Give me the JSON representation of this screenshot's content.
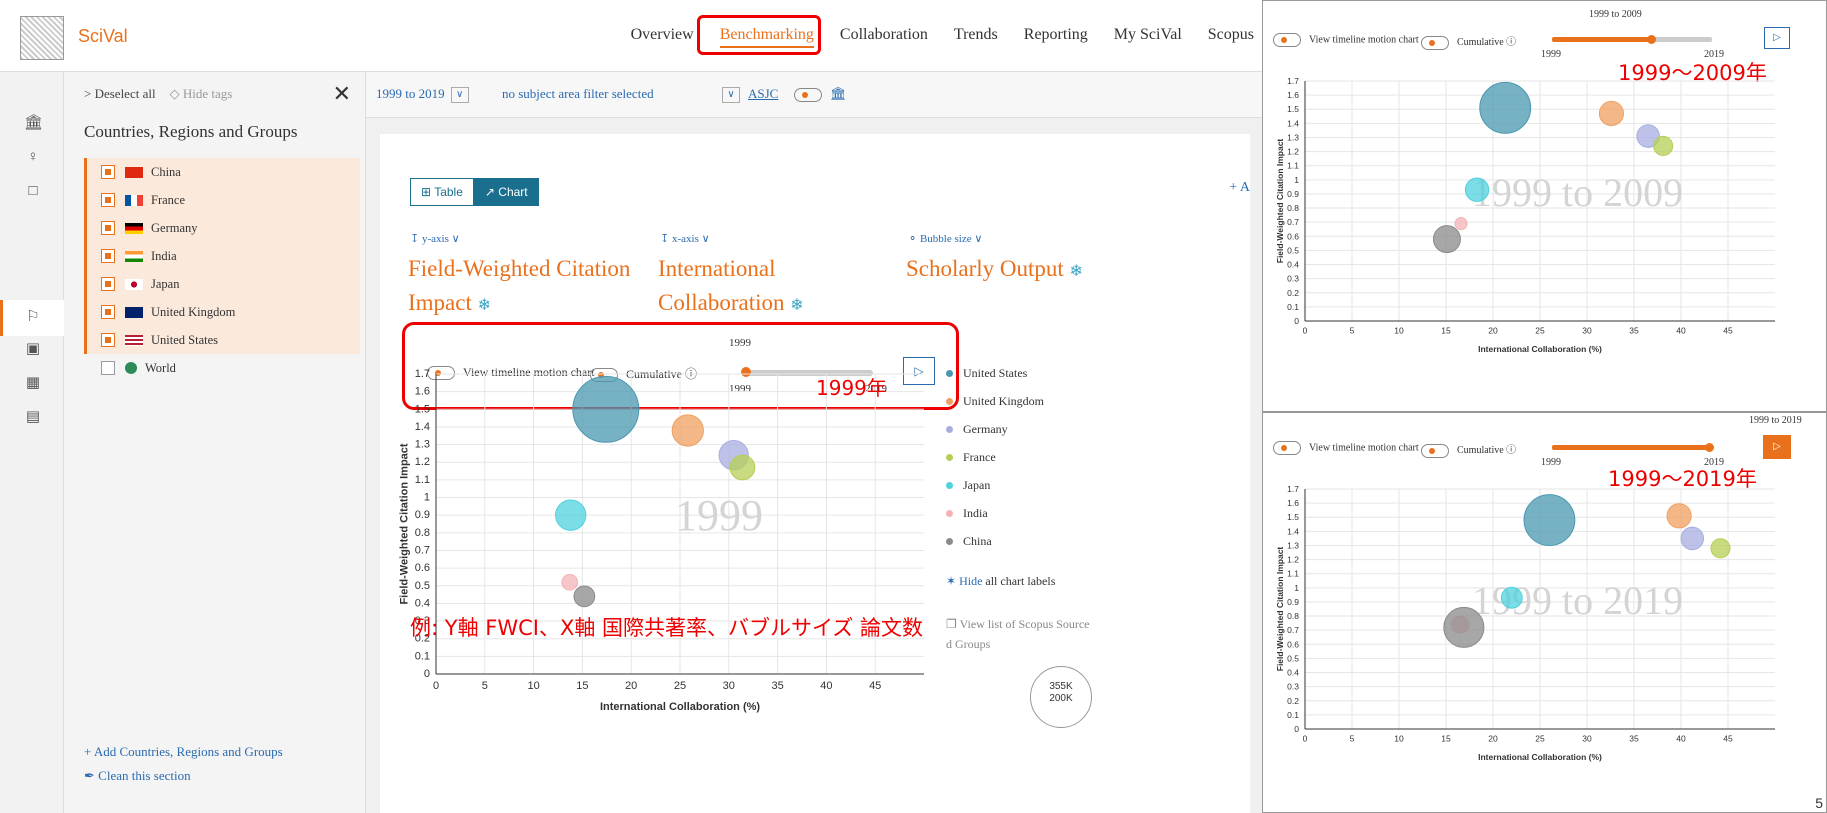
{
  "app": {
    "brand": "SciVal"
  },
  "nav": {
    "items": [
      "Overview",
      "Benchmarking",
      "Collaboration",
      "Trends",
      "Reporting",
      "My SciVal",
      "Scopus"
    ],
    "active": "Benchmarking"
  },
  "panel": {
    "deselect_all": "> Deselect all",
    "hide_tags": "Hide tags",
    "title": "Countries, Regions and Groups",
    "countries": [
      {
        "name": "China",
        "selected": true
      },
      {
        "name": "France",
        "selected": true
      },
      {
        "name": "Germany",
        "selected": true
      },
      {
        "name": "India",
        "selected": true
      },
      {
        "name": "Japan",
        "selected": true
      },
      {
        "name": "United Kingdom",
        "selected": true
      },
      {
        "name": "United States",
        "selected": true
      },
      {
        "name": "World",
        "selected": false
      }
    ],
    "add_link": "+ Add Countries, Regions and Groups",
    "clean_link": "Clean this section"
  },
  "filterbar": {
    "year_range": "1999 to 2019",
    "subject_filter": "no subject area filter selected",
    "asjc": "ASJC"
  },
  "view": {
    "table_label": "Table",
    "chart_label": "Chart",
    "add_label": "+ A"
  },
  "axes": {
    "y_selector": "y-axis",
    "x_selector": "x-axis",
    "size_selector": "Bubble size",
    "y_metric_line1": "Field-Weighted Citation",
    "y_metric_line2": "Impact",
    "x_metric_line1": "International",
    "x_metric_line2": "Collaboration",
    "size_metric": "Scholarly Output"
  },
  "timeline": {
    "view_motion": "View timeline motion chart",
    "cumulative": "Cumulative",
    "current_year": "1999",
    "start_year": "1999",
    "end_year": "2019",
    "position_fraction": 0
  },
  "legend": [
    {
      "name": "United States",
      "color": "#4a98b0"
    },
    {
      "name": "United Kingdom",
      "color": "#f0a060"
    },
    {
      "name": "Germany",
      "color": "#a8aee0"
    },
    {
      "name": "France",
      "color": "#b5cf55"
    },
    {
      "name": "Japan",
      "color": "#4fd2dc"
    },
    {
      "name": "India",
      "color": "#f3b3b6"
    },
    {
      "name": "China",
      "color": "#8a8a8a"
    }
  ],
  "hide_labels": {
    "link": "Hide",
    "text": "all chart labels"
  },
  "scopus_list": {
    "line1": "View list of Scopus Source",
    "line2": "d Groups"
  },
  "size_legend": {
    "large": "355K",
    "small": "200K"
  },
  "annotations": {
    "main_year": "1999年",
    "main_note": "例: Y軸 FWCI、X軸 国際共著率、バブルサイズ 論文数",
    "ov1_note": "1999〜2009年",
    "ov2_note": "1999〜2019年",
    "page_number": "5"
  },
  "chart_data": [
    {
      "type": "scatter",
      "title": "",
      "watermark": "1999",
      "xlabel": "International Collaboration (%)",
      "ylabel": "Field-Weighted Citation Impact",
      "xlim": [
        0,
        50
      ],
      "ylim": [
        0,
        1.7
      ],
      "xticks": [
        0,
        5,
        10,
        15,
        20,
        25,
        30,
        35,
        40,
        45
      ],
      "yticks": [
        0,
        0.1,
        0.2,
        0.3,
        0.4,
        0.5,
        0.6,
        0.7,
        0.8,
        0.9,
        1,
        1.1,
        1.2,
        1.3,
        1.4,
        1.5,
        1.6,
        1.7
      ],
      "points": [
        {
          "series": "United States",
          "x": 17.4,
          "y": 1.5,
          "size": 355
        },
        {
          "series": "United Kingdom",
          "x": 25.8,
          "y": 1.38,
          "size": 80
        },
        {
          "series": "Germany",
          "x": 30.5,
          "y": 1.24,
          "size": 70
        },
        {
          "series": "France",
          "x": 31.4,
          "y": 1.17,
          "size": 50
        },
        {
          "series": "Japan",
          "x": 13.8,
          "y": 0.9,
          "size": 75
        },
        {
          "series": "India",
          "x": 13.7,
          "y": 0.52,
          "size": 20
        },
        {
          "series": "China",
          "x": 15.2,
          "y": 0.44,
          "size": 35
        }
      ]
    },
    {
      "type": "scatter",
      "title": "1999 to 2009",
      "watermark": "1999 to 2009",
      "xlabel": "International Collaboration (%)",
      "ylabel": "Field-Weighted Citation Impact",
      "xlim": [
        0,
        50
      ],
      "ylim": [
        0,
        1.7
      ],
      "xticks": [
        0,
        5,
        10,
        15,
        20,
        25,
        30,
        35,
        40,
        45
      ],
      "yticks": [
        0,
        0.1,
        0.2,
        0.3,
        0.4,
        0.5,
        0.6,
        0.7,
        0.8,
        0.9,
        1,
        1.1,
        1.2,
        1.3,
        1.4,
        1.5,
        1.6,
        1.7
      ],
      "points": [
        {
          "series": "United States",
          "x": 21.3,
          "y": 1.51,
          "size": 355
        },
        {
          "series": "United Kingdom",
          "x": 32.6,
          "y": 1.47,
          "size": 80
        },
        {
          "series": "Germany",
          "x": 36.5,
          "y": 1.31,
          "size": 70
        },
        {
          "series": "France",
          "x": 38.1,
          "y": 1.24,
          "size": 50
        },
        {
          "series": "Japan",
          "x": 18.3,
          "y": 0.93,
          "size": 75
        },
        {
          "series": "India",
          "x": 16.6,
          "y": 0.69,
          "size": 20
        },
        {
          "series": "China",
          "x": 15.1,
          "y": 0.58,
          "size": 100
        }
      ]
    },
    {
      "type": "scatter",
      "title": "1999 to 2019",
      "watermark": "1999 to 2019",
      "xlabel": "International Collaboration (%)",
      "ylabel": "Field-Weighted Citation Impact",
      "xlim": [
        0,
        50
      ],
      "ylim": [
        0,
        1.7
      ],
      "xticks": [
        0,
        5,
        10,
        15,
        20,
        25,
        30,
        35,
        40,
        45
      ],
      "yticks": [
        0,
        0.1,
        0.2,
        0.3,
        0.4,
        0.5,
        0.6,
        0.7,
        0.8,
        0.9,
        1,
        1.1,
        1.2,
        1.3,
        1.4,
        1.5,
        1.6,
        1.7
      ],
      "points": [
        {
          "series": "United States",
          "x": 26.0,
          "y": 1.48,
          "size": 355
        },
        {
          "series": "United Kingdom",
          "x": 39.8,
          "y": 1.51,
          "size": 80
        },
        {
          "series": "Germany",
          "x": 41.2,
          "y": 1.35,
          "size": 70
        },
        {
          "series": "France",
          "x": 44.2,
          "y": 1.28,
          "size": 50
        },
        {
          "series": "Japan",
          "x": 22.0,
          "y": 0.93,
          "size": 60
        },
        {
          "series": "India",
          "x": 16.5,
          "y": 0.74,
          "size": 40
        },
        {
          "series": "China",
          "x": 16.9,
          "y": 0.72,
          "size": 220
        }
      ]
    }
  ]
}
